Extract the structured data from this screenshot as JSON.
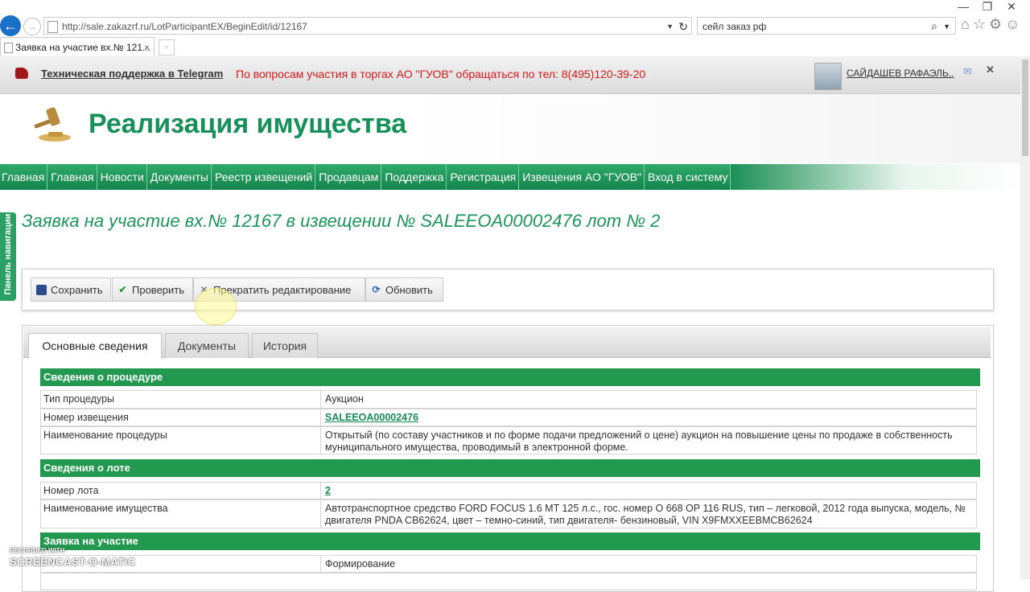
{
  "browser": {
    "url": "http://sale.zakazrf.ru/LotParticipantEX/BeginEdit/id/12167",
    "search_text": "сейл заказ рф",
    "tab_title": "Заявка на участие вх.№ 121...",
    "tab_close": "×",
    "win_minimize": "—",
    "win_restore": "❐",
    "win_close": "✕"
  },
  "infobar": {
    "telegram_link": "Техническая поддержка в Telegram",
    "message": "По вопросам участия в торгах АО \"ГУОВ\" обращаться по тел: 8(495)120-39-20",
    "user_name": "САЙДАШЕВ РАФАЭЛЬ..",
    "close": "✕"
  },
  "header": {
    "site_title": "Реализация имущества"
  },
  "nav": {
    "items": [
      "Главная",
      "Главная",
      "Новости",
      "Документы",
      "Реестр извещений",
      "Продавцам",
      "Поддержка",
      "Регистрация",
      "Извещения АО \"ГУОВ\"",
      "Вход в систему"
    ]
  },
  "side_panel": {
    "label": "Панель навигации"
  },
  "page": {
    "heading": "Заявка на участие вх.№ 12167 в извещении № SALEEOA00002476 лот № 2"
  },
  "toolbar": {
    "save": "Сохранить",
    "check": "Проверить",
    "stop_edit": "Прекратить редактирование",
    "refresh": "Обновить"
  },
  "content_tabs": [
    "Основные сведения",
    "Документы",
    "История"
  ],
  "sections": {
    "procedure": {
      "title": "Сведения о процедуре",
      "rows": [
        {
          "label": "Тип процедуры",
          "value": "Аукцион"
        },
        {
          "label": "Номер извещения",
          "value": "SALEEOA00002476"
        },
        {
          "label": "Наименование процедуры",
          "value": "Открытый (по составу участников и по форме подачи предложений о цене) аукцион на повышение цены по продаже в собственность муниципального имущества, проводимый в электронной форме."
        }
      ]
    },
    "lot": {
      "title": "Сведения о лоте",
      "rows": [
        {
          "label": "Номер лота",
          "value": "2"
        },
        {
          "label": "Наименование имущества",
          "value": "Автотранспортное средство FORD FOCUS 1.6 MT 125 л.с., гос. номер О 668 ОР 116 RUS, тип – легковой, 2012 года выпуска, модель, № двигателя PNDA CB62624, цвет – темно-синий, тип двигателя- бензиновый, VIN X9FMXXEEBMCB62624"
        }
      ]
    },
    "application": {
      "title": "Заявка на участие",
      "rows": [
        {
          "label": "",
          "value": "Формирование"
        }
      ]
    }
  },
  "watermark": {
    "line1": "RECORDED WITH",
    "line2": "SCREENCAST-O-MATIC"
  },
  "colors": {
    "brand_green": "#22994f",
    "alert_red": "#d21a1a",
    "browser_blue": "#1a6fc6"
  }
}
